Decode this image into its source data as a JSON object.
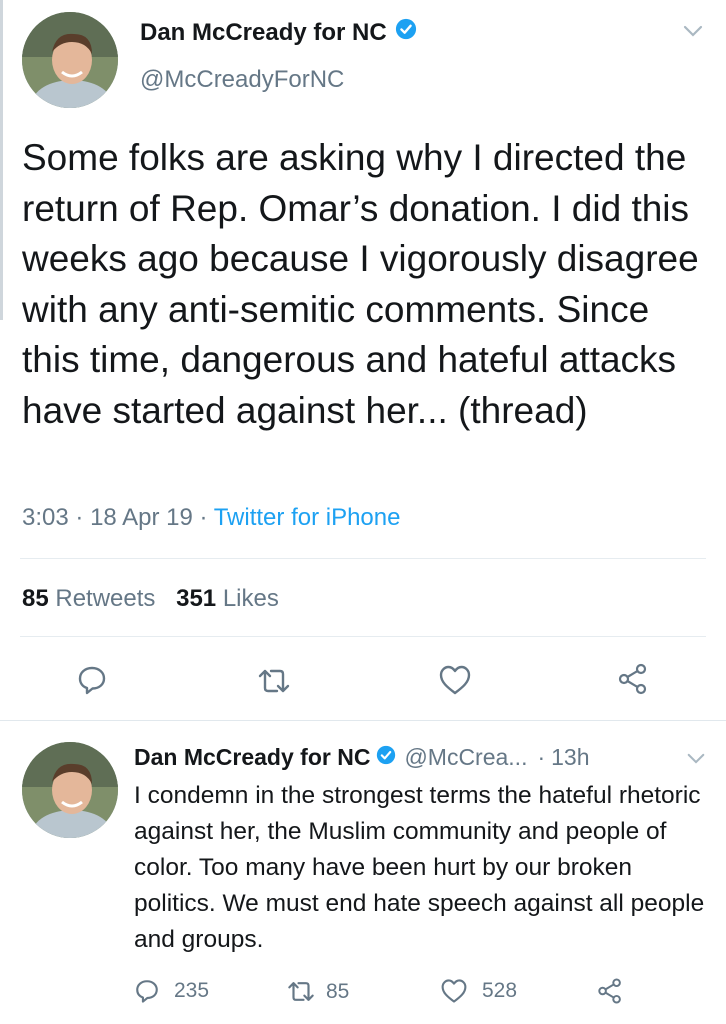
{
  "main_tweet": {
    "display_name": "Dan McCready for NC",
    "handle": "@McCreadyForNC",
    "text": "Some folks are asking why I directed the return of Rep. Omar’s donation. I did this weeks ago because I vigorously disagree with any anti-semitic comments. Since this time, dangerous and hateful attacks have started against her... (thread)",
    "time": "3:03",
    "sep1": "·",
    "date": "18 Apr 19",
    "sep2": "·",
    "source": "Twitter for iPhone",
    "retweets_count": "85",
    "retweets_label": "Retweets",
    "likes_count": "351",
    "likes_label": "Likes"
  },
  "reply_tweet": {
    "display_name": "Dan McCready for NC",
    "handle": "@McCrea...",
    "sep": "·",
    "age": "13h",
    "text": "I condemn in the strongest terms the hateful rhetoric against her, the Muslim community and people of color. Too many have been hurt by our broken politics. We must end hate speech against all people and groups.",
    "reply_count": "235",
    "retweet_count": "85",
    "like_count": "528"
  },
  "icons": {
    "verified": "verified-badge-icon",
    "chevron": "chevron-down-icon",
    "reply": "reply-icon",
    "retweet": "retweet-icon",
    "like": "heart-icon",
    "share": "share-icon"
  },
  "colors": {
    "accent": "#1da1f2",
    "secondary_text": "#657786",
    "icon_gray": "#657786"
  }
}
